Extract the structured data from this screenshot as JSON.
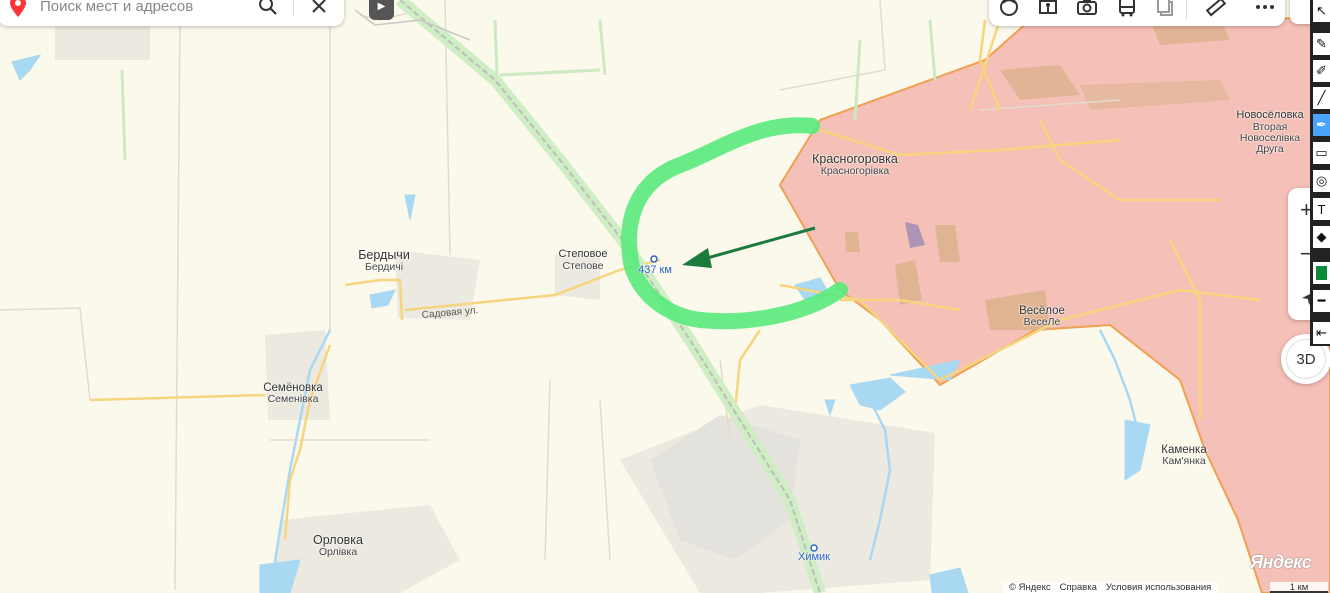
{
  "search": {
    "placeholder": "Поиск мест и адресов"
  },
  "icons": [
    "location-pin-icon",
    "search-icon",
    "close-icon",
    "play-icon",
    "layers-icon",
    "panorama-icon",
    "camera-icon",
    "bus-icon",
    "copy-icon",
    "ruler-icon",
    "more-icon",
    "cursor-icon",
    "pencil-icon",
    "marker-icon",
    "line-icon",
    "polygon-icon",
    "rectangle-icon",
    "placemark-icon",
    "text-icon",
    "eraser-icon",
    "color-swatch-icon",
    "stroke-icon",
    "collapse-icon",
    "zoom-in-icon",
    "zoom-out-icon",
    "geolocation-icon"
  ],
  "colors": {
    "occupied_area": "#f19a94",
    "occupied_border": "#f0a050",
    "highlight_line": "#59ea7c",
    "arrow": "#1c7a3c",
    "road": "#f6d57e",
    "water": "#a8d8f2",
    "poi": "#2d63c7"
  },
  "places": {
    "krasnogorovka": {
      "name": "Красногоровка",
      "sub": "Красногорівка"
    },
    "novoselovka": {
      "name": "Новосёловка",
      "sub1": "Вторая",
      "sub2": "Новоселівка",
      "sub3": "Друга"
    },
    "stepovoe": {
      "name": "Степовое",
      "sub": "Степове"
    },
    "berdychi": {
      "name": "Бердычи",
      "sub": "Бердичі"
    },
    "semenovka": {
      "name": "Семёновка",
      "sub": "Семенівка"
    },
    "veseloe": {
      "name": "Весёлое",
      "sub": "ВесеЛе"
    },
    "kamenka": {
      "name": "Каменка",
      "sub": "Кам'янка"
    },
    "orlovka": {
      "name": "Орловка",
      "sub": "Орлівка"
    }
  },
  "pois": {
    "km437": "437 км",
    "khimik": "Химик"
  },
  "streets": {
    "sadovaya": "Садовая ул."
  },
  "controls": {
    "btn_3d": "3D",
    "zoom_in": "+",
    "zoom_out": "−"
  },
  "footer": {
    "copyright": "© Яндекс",
    "help": "Справка",
    "terms": "Условия использования",
    "scale": "1 км"
  },
  "brand": "Яндекс"
}
